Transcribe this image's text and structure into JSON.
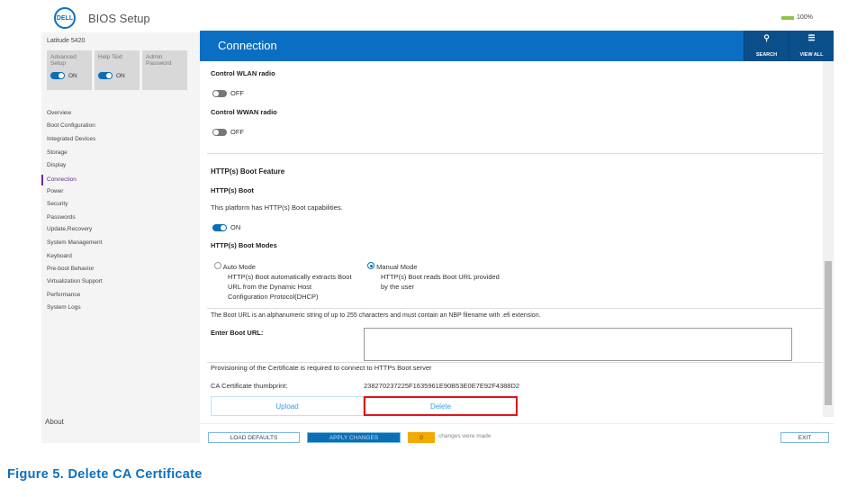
{
  "app": {
    "logo": "DELL",
    "title": "BIOS Setup",
    "battery": "100%"
  },
  "sidebar": {
    "model": "Latitude 5420",
    "tiles": [
      {
        "label": "Advanced Setup",
        "toggle": "ON"
      },
      {
        "label": "Help Text",
        "toggle": "ON"
      },
      {
        "label": "Admin Password"
      }
    ],
    "items": [
      "Overview",
      "Boot Configuration",
      "Integrated Devices",
      "Storage",
      "Display",
      "Connection",
      "Power",
      "Security",
      "Passwords",
      "Update,Recovery",
      "System Management",
      "Keyboard",
      "Pre-boot Behavior",
      "Virtualization Support",
      "Performance",
      "System Logs"
    ],
    "active": "Connection",
    "about": "About"
  },
  "header": {
    "title": "Connection",
    "search": "SEARCH",
    "view_all": "VIEW ALL"
  },
  "content": {
    "wlan_label": "Control WLAN radio",
    "wlan_state": "OFF",
    "wwan_label": "Control WWAN radio",
    "wwan_state": "OFF",
    "section": "HTTP(s) Boot Feature",
    "boot_label": "HTTP(s) Boot",
    "boot_desc": "This platform has HTTP(s) Boot capabilities.",
    "boot_state": "ON",
    "modes_label": "HTTP(s) Boot Modes",
    "auto": {
      "title": "Auto Mode",
      "desc": [
        "HTTP(s) Boot automatically extracts Boot",
        "URL from the Dynamic Host",
        "Configuration Protocol(DHCP)"
      ]
    },
    "manual": {
      "title": "Manual Mode",
      "desc": [
        "HTTP(s) Boot reads Boot URL provided",
        "by the user"
      ]
    },
    "url_note": "The Boot URL is an alphanumeric string of up to 255 characters and must contain an NBP filename with .efi extension.",
    "url_label": "Enter Boot URL:",
    "url_value": "",
    "cert_note": "Provisioning of the Certificate is required to connect to HTTPs Boot server",
    "thumb_label": "CA Certificate thumbprint:",
    "thumb_value": "238270237225F1635961E90B53E0E7E92F4388D2",
    "upload": "Upload",
    "delete": "Delete"
  },
  "footer": {
    "load_defaults": "LOAD DEFAULTS",
    "apply": "APPLY CHANGES",
    "count": "0",
    "changes_text": "changes were made",
    "exit": "EXIT"
  },
  "caption": "Figure 5. Delete CA Certificate",
  "colors": {
    "accent": "#0a6fc2",
    "highlight": "#e0141e",
    "active_nav": "#6b2c91"
  }
}
